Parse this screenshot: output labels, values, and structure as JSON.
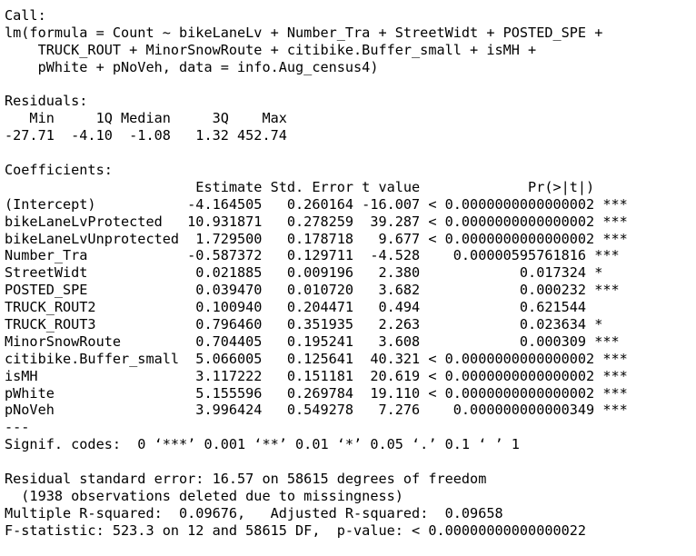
{
  "console": {
    "lines": [
      "Call:",
      "lm(formula = Count ~ bikeLaneLv + Number_Tra + StreetWidt + POSTED_SPE +",
      "    TRUCK_ROUT + MinorSnowRoute + citibike.Buffer_small + isMH +",
      "    pWhite + pNoVeh, data = info.Aug_census4)",
      "",
      "Residuals:",
      "   Min     1Q Median     3Q    Max ",
      "-27.71  -4.10  -1.08   1.32 452.74 ",
      "",
      "Coefficients:",
      "                       Estimate Std. Error t value             Pr(>|t|)    ",
      "(Intercept)           -4.164505   0.260164 -16.007 < 0.0000000000000002 ***",
      "bikeLaneLvProtected   10.931871   0.278259  39.287 < 0.0000000000000002 ***",
      "bikeLaneLvUnprotected  1.729500   0.178718   9.677 < 0.0000000000000002 ***",
      "Number_Tra            -0.587372   0.129711  -4.528    0.00000595761816 ***",
      "StreetWidt             0.021885   0.009196   2.380            0.017324 *  ",
      "POSTED_SPE             0.039470   0.010720   3.682            0.000232 ***",
      "TRUCK_ROUT2            0.100940   0.204471   0.494            0.621544    ",
      "TRUCK_ROUT3            0.796460   0.351935   2.263            0.023634 *  ",
      "MinorSnowRoute         0.704405   0.195241   3.608            0.000309 ***",
      "citibike.Buffer_small  5.066005   0.125641  40.321 < 0.0000000000000002 ***",
      "isMH                   3.117222   0.151181  20.619 < 0.0000000000000002 ***",
      "pWhite                 5.155596   0.269784  19.110 < 0.0000000000000002 ***",
      "pNoVeh                 3.996424   0.549278   7.276    0.000000000000349 ***",
      "---",
      "Signif. codes:  0 ‘***’ 0.001 ‘**’ 0.01 ‘*’ 0.05 ‘.’ 0.1 ‘ ’ 1",
      "",
      "Residual standard error: 16.57 on 58615 degrees of freedom",
      "  (1938 observations deleted due to missingness)",
      "Multiple R-squared:  0.09676,\tAdjusted R-squared:  0.09658 ",
      "F-statistic: 523.3 on 12 and 58615 DF,  p-value: < 0.00000000000000022"
    ]
  }
}
